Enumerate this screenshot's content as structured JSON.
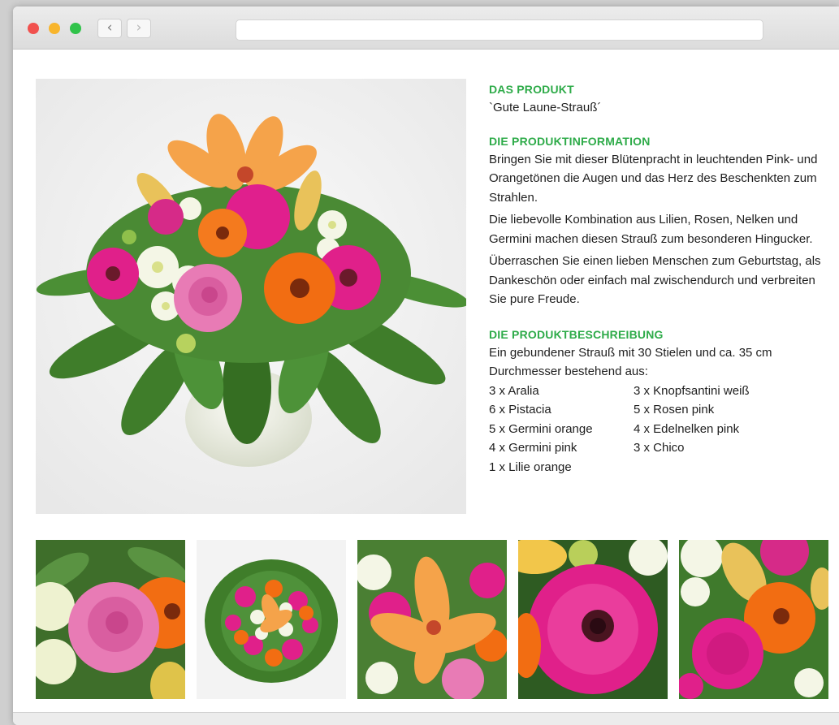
{
  "window": {
    "url": ""
  },
  "product": {
    "heading1": "DAS PRODUKT",
    "name": "`Gute Laune-Strauß´",
    "heading2": "DIE PRODUKTINFORMATION",
    "paragraphs": [
      "Bringen Sie mit dieser Blütenpracht in leuchtenden Pink- und Orangetönen die Augen und das Herz des Beschenkten zum Strahlen.",
      "Die liebevolle Kombination aus Lilien, Rosen, Nelken und Germini machen diesen Strauß zum besonderen Hingucker.",
      "Überraschen Sie einen lieben Menschen zum Geburtstag, als Dankeschön oder einfach mal zwischendurch und verbreiten Sie pure Freude."
    ],
    "heading3": "DIE PRODUKTBESCHREIBUNG",
    "description": "Ein gebundener Strauß mit 30 Stielen und ca. 35 cm Durchmesser bestehend aus:",
    "ingredients": [
      "3 x Aralia",
      "3 x Knopfsantini weiß",
      "6 x Pistacia",
      "5 x Rosen pink",
      "5 x Germini orange",
      "4 x Edelnelken pink",
      "4 x Germini pink",
      "3 x Chico",
      "1 x Lilie orange"
    ]
  },
  "colors": {
    "accent_green": "#2eab49",
    "pink": "#e0208a",
    "orange": "#f26d12",
    "rose": "#e87bb5",
    "leaf": "#3f7d2a"
  },
  "icons": {
    "back": "chevron-left-icon",
    "forward": "chevron-right-icon"
  }
}
